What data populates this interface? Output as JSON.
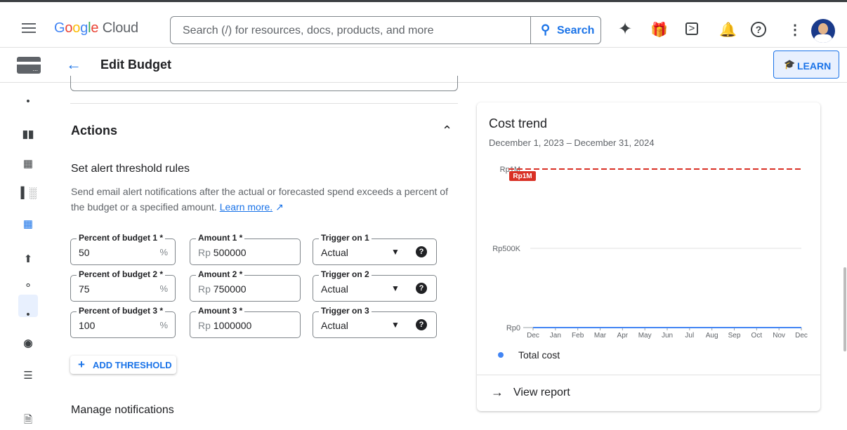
{
  "app": {
    "name": "Google Cloud",
    "logo_letters": [
      "G",
      "o",
      "o",
      "g",
      "l",
      "e"
    ],
    "logo_rest": " Cloud"
  },
  "search": {
    "placeholder": "Search (/) for resources, docs, products, and more",
    "button_label": "Search"
  },
  "header": {
    "title": "Edit Budget",
    "learn_label": "LEARN"
  },
  "actions": {
    "title": "Actions",
    "rules_title": "Set alert threshold rules",
    "rules_desc": "Send email alert notifications after the actual or forecasted spend exceeds a percent of the budget or a specified amount.",
    "learn_more": "Learn more.",
    "thresholds": [
      {
        "percent_label": "Percent of budget 1 *",
        "percent": "50",
        "amount_label": "Amount 1 *",
        "amount_prefix": "Rp",
        "amount": "500000",
        "trigger_label": "Trigger on 1",
        "trigger": "Actual"
      },
      {
        "percent_label": "Percent of budget 2 *",
        "percent": "75",
        "amount_label": "Amount 2 *",
        "amount_prefix": "Rp",
        "amount": "750000",
        "trigger_label": "Trigger on 2",
        "trigger": "Actual"
      },
      {
        "percent_label": "Percent of budget 3 *",
        "percent": "100",
        "amount_label": "Amount 3 *",
        "amount_prefix": "Rp",
        "amount": "1000000",
        "trigger_label": "Trigger on 3",
        "trigger": "Actual"
      }
    ],
    "percent_suffix": "%",
    "add_threshold_label": "ADD THRESHOLD",
    "manage_notifications": "Manage notifications"
  },
  "cost_trend": {
    "title": "Cost trend",
    "date_range": "December 1, 2023 – December 31, 2024",
    "view_report": "View report"
  },
  "chart_data": {
    "type": "line",
    "categories": [
      "Dec",
      "Jan",
      "Feb",
      "Mar",
      "Apr",
      "May",
      "Jun",
      "Jul",
      "Aug",
      "Sep",
      "Oct",
      "Nov",
      "Dec"
    ],
    "series": [
      {
        "name": "Total cost",
        "values": [
          0,
          0,
          0,
          0,
          0,
          0,
          0,
          0,
          0,
          0,
          0,
          0,
          0
        ],
        "color": "#4285f4"
      }
    ],
    "budget_line": {
      "value": 1000000,
      "label": "Rp1M",
      "color": "#d93025"
    },
    "y_ticks": [
      {
        "value": 0,
        "label": "Rp0"
      },
      {
        "value": 500000,
        "label": "Rp500K"
      },
      {
        "value": 1000000,
        "label": "Rp1M"
      }
    ],
    "ylim": [
      0,
      1000000
    ],
    "legend_position": "bottom-left"
  },
  "colors": {
    "accent": "#1a73e8",
    "budget_red": "#d93025"
  }
}
